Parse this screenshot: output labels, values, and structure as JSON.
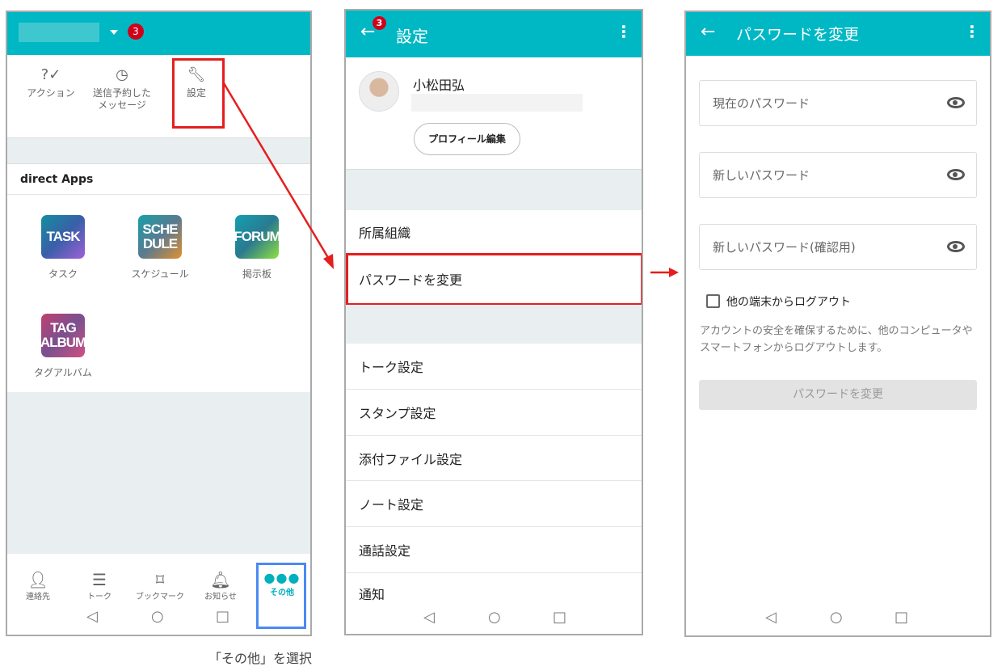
{
  "colors": {
    "header": "#00b8c4",
    "highlight_red": "#e51e1e",
    "highlight_blue": "#4a8af4",
    "badge": "#d0021b"
  },
  "screen1": {
    "badge_count": "3",
    "quick_actions": [
      {
        "label": "アクション",
        "icon": "action-icon"
      },
      {
        "label": "送信予約した\nメッセージ",
        "icon": "scheduled-message-icon"
      },
      {
        "label": "設定",
        "icon": "wrench-icon"
      }
    ],
    "apps_heading": "direct Apps",
    "apps": [
      {
        "icon_text": "TASK",
        "label": "タスク"
      },
      {
        "icon_text": "SCHE DULE",
        "label": "スケジュール"
      },
      {
        "icon_text": "FORUM",
        "label": "掲示板"
      },
      {
        "icon_text": "TAG ALBUM",
        "label": "タグアルバム"
      }
    ],
    "nav": [
      {
        "label": "連絡先"
      },
      {
        "label": "トーク"
      },
      {
        "label": "ブックマーク"
      },
      {
        "label": "お知らせ"
      },
      {
        "label": "その他"
      }
    ],
    "caption": "「その他」を選択"
  },
  "screen2": {
    "badge_count": "3",
    "title": "設定",
    "user_name": "小松田弘",
    "edit_profile": "プロフィール編集",
    "items": [
      "所属組織",
      "パスワードを変更",
      "トーク設定",
      "スタンプ設定",
      "添付ファイル設定",
      "ノート設定",
      "通話設定",
      "通知"
    ]
  },
  "screen3": {
    "title": "パスワードを変更",
    "fields": [
      "現在のパスワード",
      "新しいパスワード",
      "新しいパスワード(確認用)"
    ],
    "logout_checkbox": "他の端末からログアウト",
    "logout_checked": false,
    "description": "アカウントの安全を確保するために、他のコンピュータやスマートフォンからログアウトします。",
    "submit": "パスワードを変更"
  }
}
